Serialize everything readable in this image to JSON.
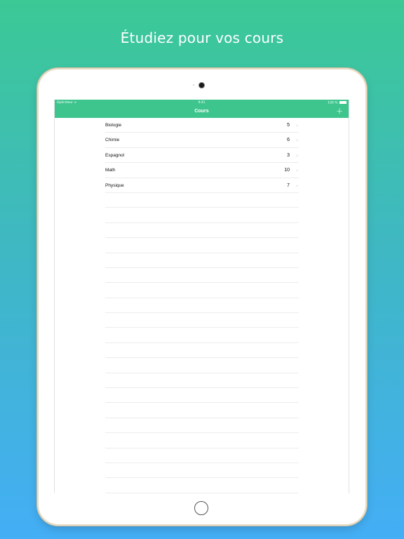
{
  "headline": "Étudiez pour vos cours",
  "status_bar": {
    "carrier": "Opérateur",
    "time": "9:41",
    "battery": "100 %"
  },
  "nav": {
    "title": "Cours",
    "add_label": "+"
  },
  "courses": [
    {
      "name": "Biologie",
      "count": "5"
    },
    {
      "name": "Chimie",
      "count": "6"
    },
    {
      "name": "Espagnol",
      "count": "3"
    },
    {
      "name": "Math",
      "count": "10"
    },
    {
      "name": "Physique",
      "count": "7"
    }
  ],
  "chevron": "›",
  "colors": {
    "nav_green": "#3ec58e",
    "gradient_top": "#3cc995",
    "gradient_bottom": "#44aef6"
  }
}
